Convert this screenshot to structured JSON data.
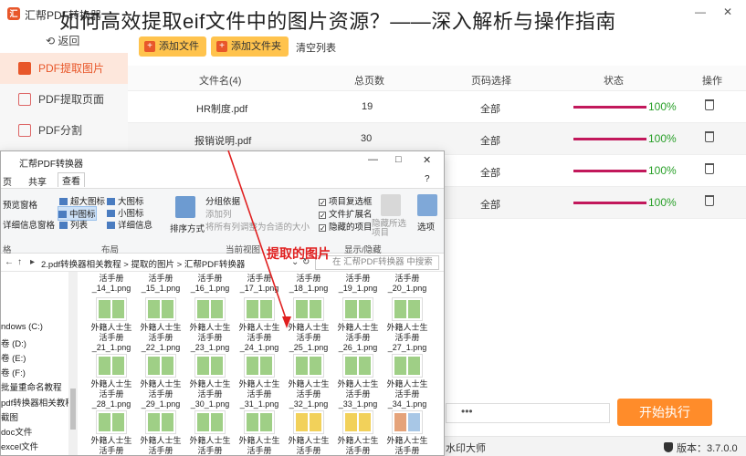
{
  "headline": "如何高效提取eif文件中的图片资源？——深入解析与操作指南",
  "app": {
    "title": "汇帮PDF转换器",
    "back_label": "返回",
    "window_controls": [
      "—",
      "□",
      "✕"
    ],
    "toolbar": {
      "add_file": "添加文件",
      "add_folder": "添加文件夹",
      "clear_list": "清空列表"
    },
    "sidebar": [
      {
        "label": "PDF提取图片",
        "active": true
      },
      {
        "label": "PDF提取页面",
        "active": false
      },
      {
        "label": "PDF分割",
        "active": false
      }
    ],
    "table": {
      "headers": [
        "文件名(4)",
        "总页数",
        "页码选择",
        "状态",
        "操作"
      ],
      "rows": [
        {
          "name": "HR制度.pdf",
          "pages": "19",
          "range": "全部",
          "status": "100%"
        },
        {
          "name": "报销说明.pdf",
          "pages": "30",
          "range": "全部",
          "status": "100%"
        },
        {
          "name": "",
          "pages": "",
          "range": "全部",
          "status": "100%"
        },
        {
          "name": "",
          "pages": "",
          "range": "全部",
          "status": "100%"
        }
      ]
    },
    "start_button": "开始执行",
    "footer_left": "水印大师",
    "footer_version": "版本：3.7.0.0",
    "accent": "#e8572a",
    "progress_color": "#c2185b",
    "percent_color": "#2aa02a"
  },
  "explorer": {
    "title": "汇帮PDF转换器",
    "tabs": [
      "页",
      "共享",
      "查看"
    ],
    "ribbon": {
      "pane_items": [
        "预览窗格",
        "详细信息窗格"
      ],
      "layout_items": [
        "超大图标",
        "大图标",
        "中图标",
        "小图标",
        "列表",
        "详细信息"
      ],
      "sort_label": "排序方式",
      "group_items": [
        "分组依据",
        "添加列",
        "将所有列调整为合适的大小"
      ],
      "show_items": [
        "项目复选框",
        "文件扩展名",
        "隐藏的项目"
      ],
      "hide_selected": "隐藏所选项目",
      "options": "选项",
      "groups": [
        "格",
        "布局",
        "当前视图",
        "显示/隐藏"
      ]
    },
    "address": [
      "2.pdf转换器相关教程",
      "提取的图片",
      "汇帮PDF转换器"
    ],
    "search_placeholder": "在 汇帮PDF转换器 中搜索",
    "nav": [
      "",
      "",
      "",
      "ndows (C:)",
      "卷 (D:)",
      "卷 (E:)",
      "卷 (F:)",
      "批量重命名教程",
      "pdf转换器相关教程",
      "截图",
      "doc文件",
      "excel文件"
    ],
    "top_row_files": [
      "_14_1.png",
      "_15_1.png",
      "_16_1.png",
      "_17_1.png",
      "_18_1.png",
      "_19_1.png",
      "_20_1.png"
    ],
    "files": [
      [
        "_21_1.png",
        "_22_1.png",
        "_23_1.png",
        "_24_1.png",
        "_25_1.png",
        "_26_1.png",
        "_27_1.png"
      ],
      [
        "_28_1.png",
        "_29_1.png",
        "_30_1.png",
        "_31_1.png",
        "_32_1.png",
        "_33_1.png",
        "_34_1.png"
      ],
      [
        "",
        "",
        "",
        "",
        "",
        "",
        ""
      ]
    ],
    "file_prefix_top": "活手册",
    "file_prefix_line1": "外籍人士生",
    "file_prefix_line2": "活手册"
  },
  "annotation": {
    "label": "提取的图片",
    "color": "#e02020"
  }
}
